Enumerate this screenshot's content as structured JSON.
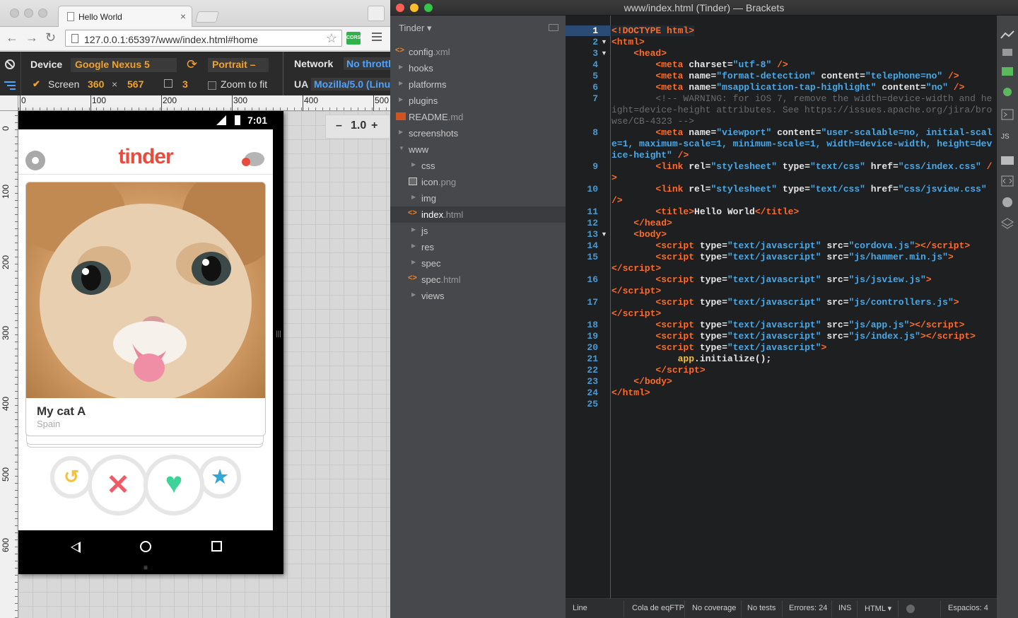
{
  "chrome": {
    "tab_title": "Hello World",
    "tab_close": "×",
    "url": "127.0.0.1:65397/www/index.html#home",
    "cors_badge": "CORS"
  },
  "emulation": {
    "device_label": "Device",
    "device_value": "Google Nexus 5",
    "orientation_value": "Portrait –",
    "network_label": "Network",
    "network_value": "No throttl",
    "screen_label": "Screen",
    "screen_width": "360",
    "screen_times": "×",
    "screen_height": "567",
    "dpr_value": "3",
    "zoom_to_fit_label": "Zoom to fit",
    "ua_label": "UA",
    "ua_value": "Mozilla/5.0 (Linu",
    "zoom_minus": "–",
    "zoom_value": "1.0",
    "zoom_plus": "+"
  },
  "rulers": {
    "top": [
      "0",
      "100",
      "200",
      "300",
      "400",
      "500"
    ],
    "left": [
      "0",
      "100",
      "200",
      "300",
      "400",
      "500",
      "600"
    ]
  },
  "phone": {
    "time": "7:01",
    "brand": "tinder",
    "card_name": "My cat A",
    "card_location": "Spain"
  },
  "brackets": {
    "window_title": "www/index.html (Tinder) — Brackets",
    "project_name": "Tinder ▾",
    "files": [
      {
        "name": "config",
        "ext": ".xml",
        "kind": "code",
        "level": 0
      },
      {
        "name": "hooks",
        "ext": "",
        "kind": "folder",
        "level": 0
      },
      {
        "name": "platforms",
        "ext": "",
        "kind": "folder",
        "level": 0
      },
      {
        "name": "plugins",
        "ext": "",
        "kind": "folder",
        "level": 0
      },
      {
        "name": "README",
        "ext": ".md",
        "kind": "md",
        "level": 0
      },
      {
        "name": "screenshots",
        "ext": "",
        "kind": "folder",
        "level": 0
      },
      {
        "name": "www",
        "ext": "",
        "kind": "folder-open",
        "level": 0
      },
      {
        "name": "css",
        "ext": "",
        "kind": "folder",
        "level": 1
      },
      {
        "name": "icon",
        "ext": ".png",
        "kind": "image",
        "level": 1
      },
      {
        "name": "img",
        "ext": "",
        "kind": "folder",
        "level": 1
      },
      {
        "name": "index",
        "ext": ".html",
        "kind": "code",
        "level": 1,
        "selected": true
      },
      {
        "name": "js",
        "ext": "",
        "kind": "folder",
        "level": 1
      },
      {
        "name": "res",
        "ext": "",
        "kind": "folder",
        "level": 1
      },
      {
        "name": "spec",
        "ext": "",
        "kind": "folder",
        "level": 1
      },
      {
        "name": "spec",
        "ext": ".html",
        "kind": "code",
        "level": 1
      },
      {
        "name": "views",
        "ext": "",
        "kind": "folder",
        "level": 1
      }
    ],
    "line_numbers": [
      "1",
      "2",
      "3",
      "4",
      "5",
      "6",
      "7",
      "8",
      "9",
      "10",
      "11",
      "12",
      "13",
      "14",
      "15",
      "16",
      "17",
      "18",
      "19",
      "20",
      "21",
      "22",
      "23",
      "24",
      "25"
    ],
    "status": {
      "line": "Line",
      "ftp": "Cola de eqFTP",
      "coverage": "No coverage",
      "tests": "No tests",
      "errors": "Errores: 24",
      "ins": "INS",
      "lang": "HTML ▾",
      "spaces": "Espacios: 4"
    }
  },
  "colors": {
    "accent_orange": "#f2a22a",
    "tinder_red": "#e94c3d",
    "brackets_line_blue": "#4b9ad1",
    "tag_orange": "#ff6b2b",
    "string_blue": "#4aa9e6"
  }
}
